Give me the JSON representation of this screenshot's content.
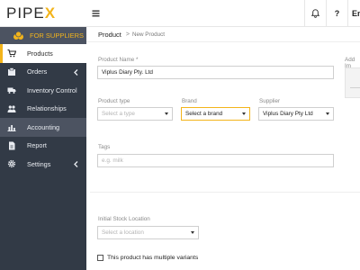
{
  "brand": {
    "logo_main": "PIPE",
    "logo_accent": "X",
    "supplier_banner": "FOR SUPPLIERS",
    "accent_color": "#f3b41b",
    "sidebar_color": "#323a46"
  },
  "sidebar": {
    "items": [
      {
        "label": "Products",
        "icon": "cart-icon"
      },
      {
        "label": "Orders",
        "icon": "orders-icon"
      },
      {
        "label": "Inventory Control",
        "icon": "truck-icon"
      },
      {
        "label": "Relationships",
        "icon": "people-icon"
      },
      {
        "label": "Accounting",
        "icon": "chart-icon"
      },
      {
        "label": "Report",
        "icon": "report-icon"
      },
      {
        "label": "Settings",
        "icon": "gear-icon"
      }
    ]
  },
  "topbar": {
    "menu_icon": "hamburger-icon",
    "bell_icon": "bell-icon",
    "help": "?",
    "language": "En"
  },
  "breadcrumb": {
    "main": "Product",
    "sub": "New Product"
  },
  "form": {
    "product_name": {
      "label": "Product Name *",
      "value": "Viplus Diary Pty. Ltd"
    },
    "add_image": {
      "label": "Add Im"
    },
    "product_type": {
      "label": "Product type",
      "placeholder": "Select a type"
    },
    "brand": {
      "label": "Brand",
      "value": "Select a brand"
    },
    "supplier": {
      "label": "Supplier",
      "value": "Viplus Diary Pty Ltd"
    },
    "tags": {
      "label": "Tags",
      "placeholder": "e.g. milk"
    },
    "stock_location": {
      "label": "Initial Stock Location",
      "placeholder": "Select a location"
    },
    "variants_checkbox": {
      "label": "This product has multiple variants"
    }
  }
}
